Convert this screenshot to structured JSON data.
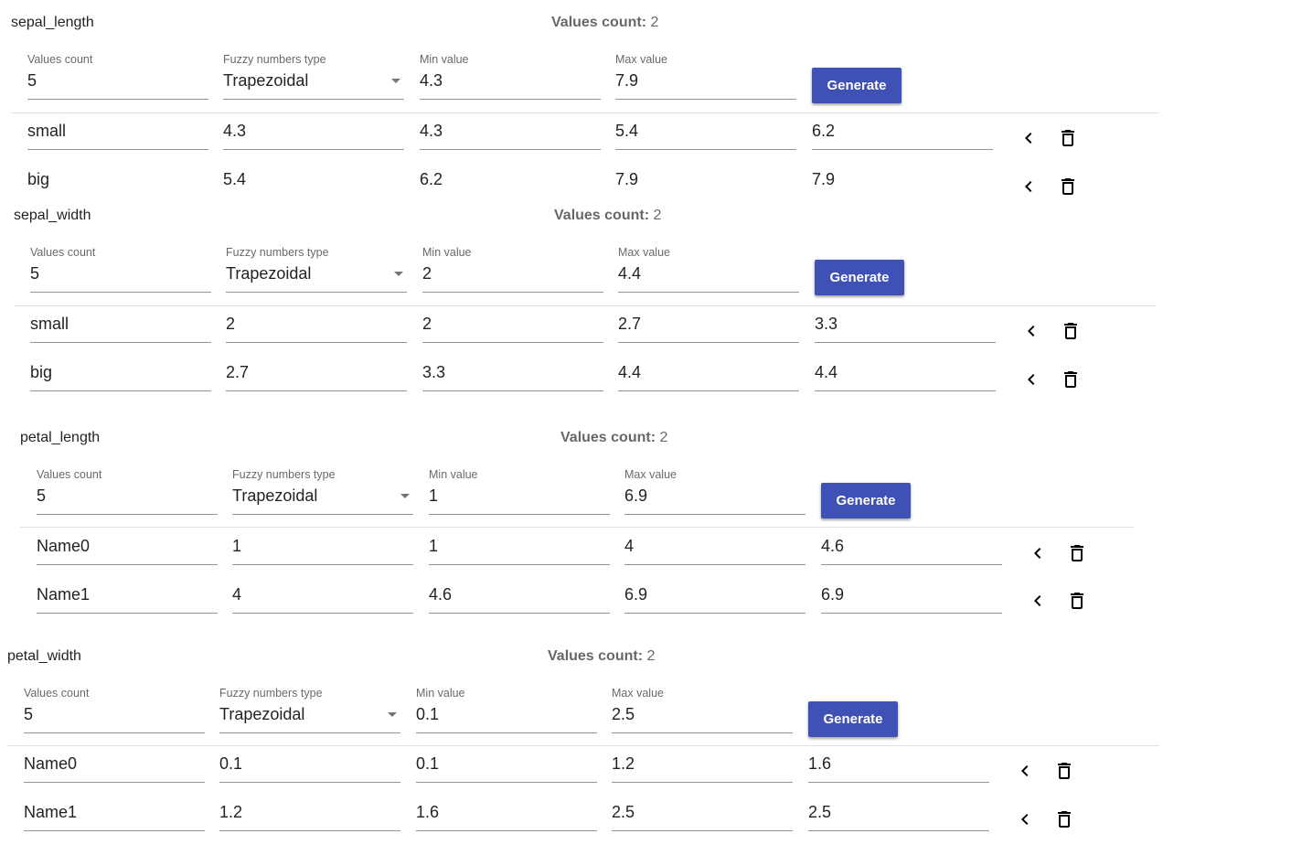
{
  "common": {
    "count_label": "Values count:",
    "values_count_label": "Values count",
    "fuzzy_type_label": "Fuzzy numbers type",
    "min_label": "Min value",
    "max_label": "Max value",
    "generate_label": "Generate"
  },
  "icons": {
    "collapse": "chevron-left-icon",
    "delete": "trash-icon"
  },
  "colors": {
    "primary": "#3f51b5"
  },
  "sections": [
    {
      "name": "sepal_length",
      "count": "2",
      "values_count": "5",
      "fuzzy_type": "Trapezoidal",
      "min": "4.3",
      "max": "7.9",
      "rows": [
        {
          "name": "small",
          "a": "4.3",
          "b": "4.3",
          "c": "5.4",
          "d": "6.2"
        },
        {
          "name": "big",
          "a": "5.4",
          "b": "6.2",
          "c": "7.9",
          "d": "7.9"
        }
      ]
    },
    {
      "name": "sepal_width",
      "count": "2",
      "values_count": "5",
      "fuzzy_type": "Trapezoidal",
      "min": "2",
      "max": "4.4",
      "rows": [
        {
          "name": "small",
          "a": "2",
          "b": "2",
          "c": "2.7",
          "d": "3.3"
        },
        {
          "name": "big",
          "a": "2.7",
          "b": "3.3",
          "c": "4.4",
          "d": "4.4"
        }
      ]
    },
    {
      "name": "petal_length",
      "count": "2",
      "values_count": "5",
      "fuzzy_type": "Trapezoidal",
      "min": "1",
      "max": "6.9",
      "rows": [
        {
          "name": "Name0",
          "a": "1",
          "b": "1",
          "c": "4",
          "d": "4.6"
        },
        {
          "name": "Name1",
          "a": "4",
          "b": "4.6",
          "c": "6.9",
          "d": "6.9"
        }
      ]
    },
    {
      "name": "petal_width",
      "count": "2",
      "values_count": "5",
      "fuzzy_type": "Trapezoidal",
      "min": "0.1",
      "max": "2.5",
      "rows": [
        {
          "name": "Name0",
          "a": "0.1",
          "b": "0.1",
          "c": "1.2",
          "d": "1.6"
        },
        {
          "name": "Name1",
          "a": "1.2",
          "b": "1.6",
          "c": "2.5",
          "d": "2.5"
        }
      ]
    }
  ]
}
